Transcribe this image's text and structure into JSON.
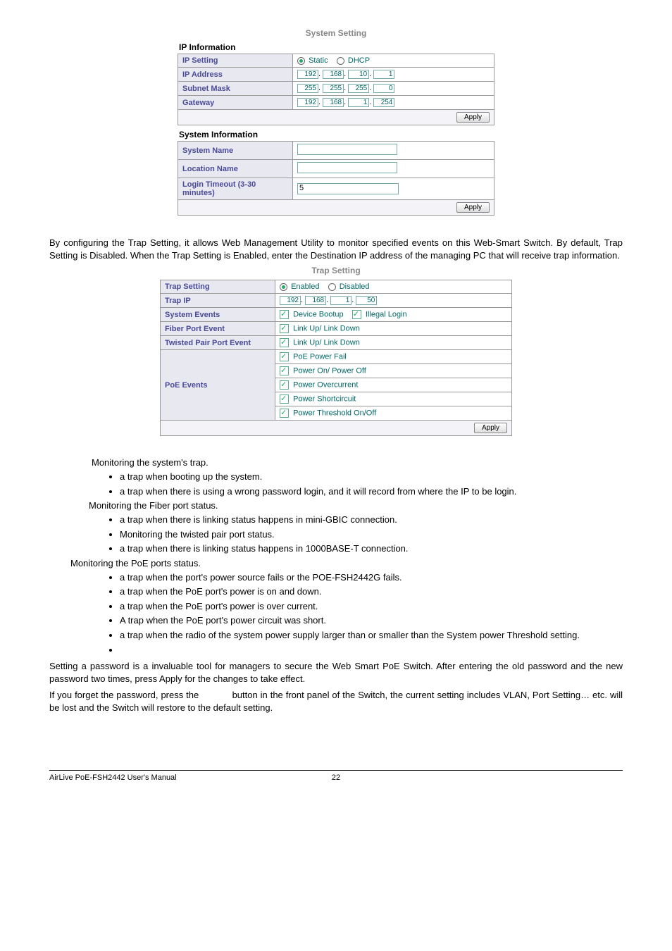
{
  "systemSetting": {
    "title": "System Setting",
    "ipInfoHeader": "IP Information",
    "rows": {
      "ipSetting": {
        "label": "IP Setting",
        "staticLabel": "Static",
        "dhcpLabel": "DHCP"
      },
      "ipAddress": {
        "label": "IP Address",
        "oct": [
          "192",
          "168",
          "10",
          "1"
        ]
      },
      "subnet": {
        "label": "Subnet Mask",
        "oct": [
          "255",
          "255",
          "255",
          "0"
        ]
      },
      "gateway": {
        "label": "Gateway",
        "oct": [
          "192",
          "168",
          "1",
          "254"
        ]
      }
    },
    "applyLabel": "Apply",
    "sysInfoHeader": "System Information",
    "sysRows": {
      "systemName": {
        "label": "System Name",
        "value": ""
      },
      "locationName": {
        "label": "Location Name",
        "value": ""
      },
      "loginTimeout": {
        "label": "Login Timeout (3-30 minutes)",
        "value": "5"
      }
    }
  },
  "trapIntro": "By configuring the Trap Setting, it allows Web Management Utility to monitor specified events on this Web-Smart Switch. By default, Trap Setting is Disabled. When the Trap Setting is Enabled, enter the Destination IP address of the managing PC that will receive trap information.",
  "trapSetting": {
    "title": "Trap Setting",
    "rows": {
      "trapSetting": {
        "label": "Trap Setting",
        "enabledLabel": "Enabled",
        "disabledLabel": "Disabled"
      },
      "trapIp": {
        "label": "Trap IP",
        "oct": [
          "192",
          "168",
          "1",
          "50"
        ]
      },
      "systemEvents": {
        "label": "System Events",
        "opt1": "Device Bootup",
        "opt2": "Illegal Login"
      },
      "fiberPort": {
        "label": "Fiber Port Event",
        "opt": "Link Up/ Link Down"
      },
      "twistedPair": {
        "label": "Twisted Pair Port Event",
        "opt": "Link Up/ Link Down"
      },
      "poeEvents": {
        "label": "PoE Events",
        "opts": [
          "PoE Power Fail",
          "Power On/ Power Off",
          "Power Overcurrent",
          "Power Shortcircuit",
          "Power Threshold On/Off"
        ]
      }
    },
    "applyLabel": "Apply"
  },
  "monitoring": {
    "sysTrap": "Monitoring the system's trap.",
    "bootup": "a trap when booting up the system.",
    "illegalLogin": "a trap when there is using a wrong password login, and it will record from where the IP to be login.",
    "fiberHeader": "Monitoring the Fiber port status.",
    "fiberLink": "a trap when there is linking status happens in mini-GBIC connection.",
    "twistedHeader": "Monitoring the twisted pair port status.",
    "twistedLink": "a trap when there is linking status happens in 1000BASE-T connection.",
    "poeHeader": "Monitoring the PoE ports status.",
    "poeFail": "a trap when the port's power source fails or the POE-FSH2442G fails.",
    "poeOnOff": "a trap when the PoE port's power is on and down.",
    "poeOver": "a trap when the PoE port's power is over current.",
    "poeShort": "A trap when the PoE port's power circuit was short.",
    "poeThreshold": "a trap when the radio of the system power supply larger than or smaller than the System power Threshold setting."
  },
  "passwordPara1": "Setting a password is a invaluable tool for managers to secure the Web Smart PoE Switch. After entering the old password and the new password two times, press Apply for the changes to take effect.",
  "passwordPara2a": "If you forget the password, press the ",
  "passwordPara2b": " button in the front panel of the Switch, the current setting includes VLAN, Port Setting… etc. will be lost and the Switch will restore to the default setting.",
  "footer": {
    "left": "AirLive PoE-FSH2442 User's Manual",
    "page": "22"
  }
}
